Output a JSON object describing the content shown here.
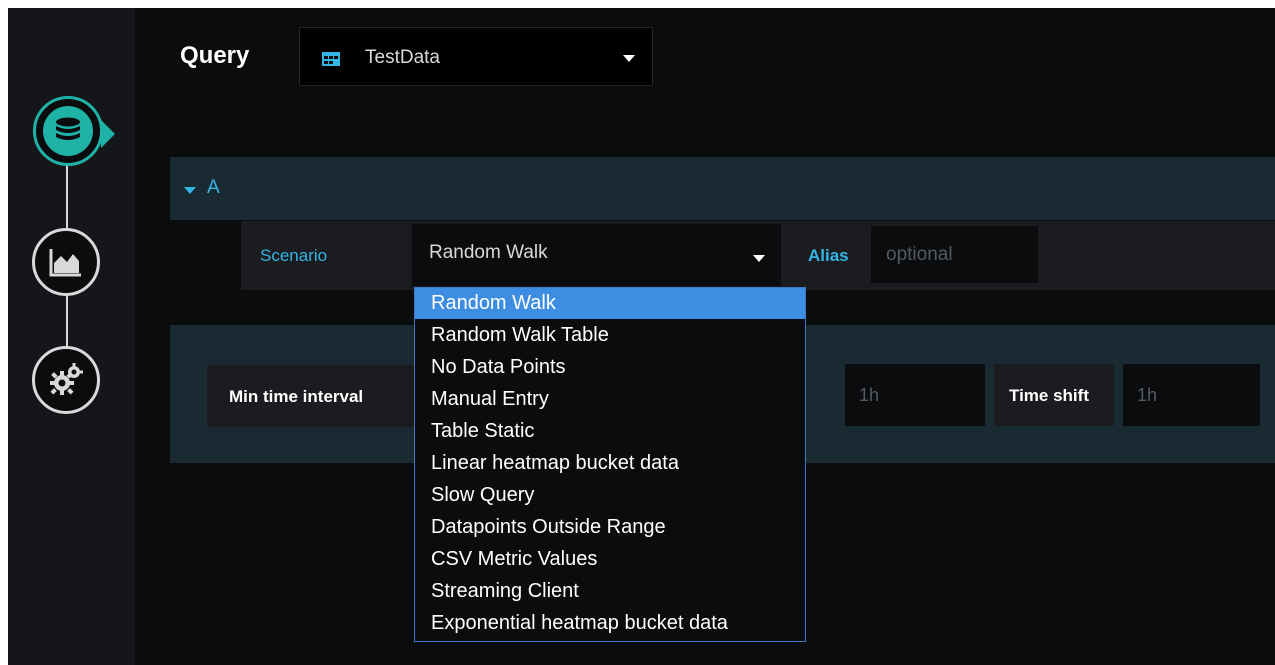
{
  "colors": {
    "background": "#0b0c0e",
    "sidebar": "#141619",
    "accent_teal": "#1fb2a6",
    "accent_blue": "#33b5e5",
    "row_bg": "#1a2a33",
    "selected_option": "#3d8de3"
  },
  "sidebar": {
    "steps": [
      {
        "icon": "database-icon",
        "active": true
      },
      {
        "icon": "area-chart-icon",
        "active": false
      },
      {
        "icon": "gears-icon",
        "active": false
      }
    ]
  },
  "header": {
    "query_label": "Query",
    "datasource": {
      "icon": "testdata-icon",
      "name": "TestData"
    }
  },
  "query_row": {
    "ref_id": "A",
    "scenario_label": "Scenario",
    "scenario_value": "Random Walk",
    "alias_label": "Alias",
    "alias_placeholder": "optional"
  },
  "options": {
    "min_interval_label": "Min time interval",
    "max_interval_placeholder": "1h",
    "time_shift_label": "Time shift",
    "time_shift_placeholder": "1h"
  },
  "scenario_dropdown": {
    "selected": "Random Walk",
    "options": [
      "Random Walk",
      "Random Walk Table",
      "No Data Points",
      "Manual Entry",
      "Table Static",
      "Linear heatmap bucket data",
      "Slow Query",
      "Datapoints Outside Range",
      "CSV Metric Values",
      "Streaming Client",
      "Exponential heatmap bucket data"
    ]
  }
}
